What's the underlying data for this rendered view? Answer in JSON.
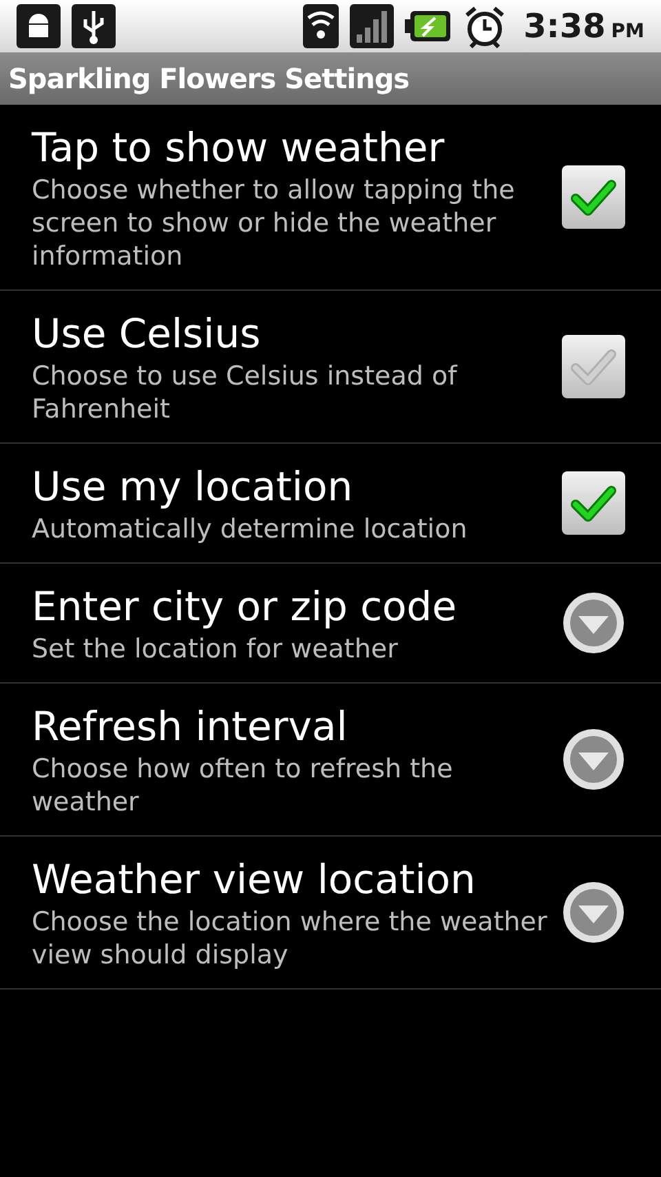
{
  "status_bar": {
    "time": "3:38",
    "ampm": "PM"
  },
  "title": "Sparkling Flowers Settings",
  "preferences": [
    {
      "kind": "checkbox",
      "title": "Tap to show weather",
      "summary": "Choose whether to allow tapping the screen to show or hide the weather information",
      "checked": true
    },
    {
      "kind": "checkbox",
      "title": "Use Celsius",
      "summary": "Choose to use Celsius instead of Fahrenheit",
      "checked": false
    },
    {
      "kind": "checkbox",
      "title": "Use my location",
      "summary": "Automatically determine location",
      "checked": true
    },
    {
      "kind": "list",
      "title": "Enter city or zip code",
      "summary": "Set the location for weather"
    },
    {
      "kind": "list",
      "title": "Refresh interval",
      "summary": "Choose how often to refresh the weather"
    },
    {
      "kind": "list",
      "title": "Weather view location",
      "summary": "Choose the location where the weather view should display"
    }
  ]
}
